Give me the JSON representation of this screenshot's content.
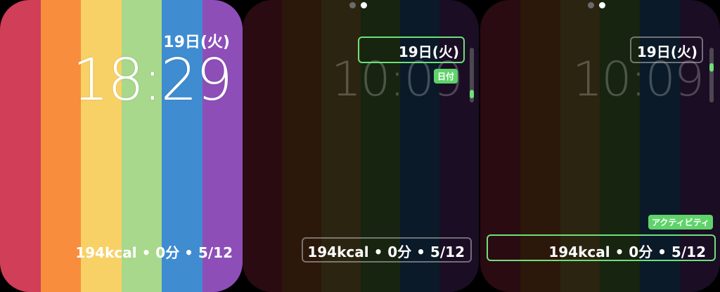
{
  "stripe_colors": [
    "#d03e58",
    "#f78d3d",
    "#f8d166",
    "#a8d88b",
    "#3f8cd1",
    "#8e4eb8"
  ],
  "faces": [
    {
      "date": "19日(火)",
      "time": "18:29",
      "complication": "194kcal • 0分 • 5/12"
    },
    {
      "date": "19日(火)",
      "time": "10:09",
      "complication": "194kcal • 0分 • 5/12",
      "tag": "日付"
    },
    {
      "date": "19日(火)",
      "time": "10:09",
      "complication": "194kcal • 0分 • 5/12",
      "tag": "アクティビティ"
    }
  ],
  "accent_color": "#6ee07a",
  "pager": {
    "count": 2,
    "active_index": 1
  }
}
